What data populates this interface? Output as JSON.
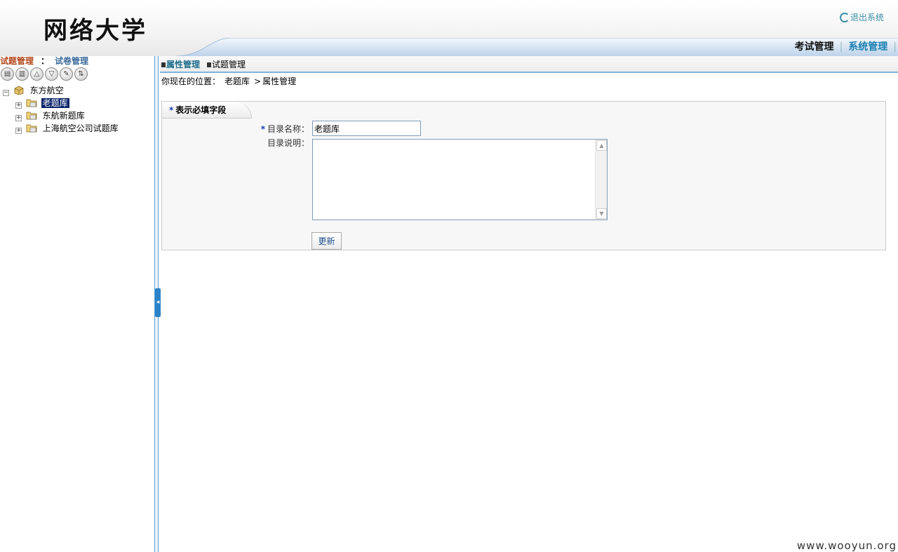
{
  "header": {
    "title": "网络大学",
    "logout_label": "退出系统",
    "nav": {
      "exam_label": "考试管理",
      "separator": "|",
      "system_label": "系统管理"
    }
  },
  "left": {
    "tab_question": "试题管理",
    "tab_colon": "：",
    "tab_paper": "试卷管理",
    "toolbar": [
      {
        "icon": "add-folder-icon"
      },
      {
        "icon": "delete-icon"
      },
      {
        "icon": "move-up-icon"
      },
      {
        "icon": "move-down-icon"
      },
      {
        "icon": "edit-icon"
      },
      {
        "icon": "sort-icon"
      }
    ],
    "tree": {
      "root": {
        "label": "东方航空",
        "expander": "−"
      },
      "children": [
        {
          "label": "老题库",
          "expander": "+",
          "selected": true
        },
        {
          "label": "东航新题库",
          "expander": "+",
          "selected": false
        },
        {
          "label": "上海航空公司试题库",
          "expander": "+",
          "selected": false
        }
      ]
    }
  },
  "main": {
    "subtabs": {
      "active": "属性管理",
      "other": "试题管理"
    },
    "breadcrumb": {
      "prefix": "你现在的位置：",
      "root": "老题库",
      "arrow": ">",
      "current": "属性管理"
    },
    "form": {
      "legend_star": "*",
      "legend": "表示必填字段",
      "name_star": "*",
      "name_label": "目录名称：",
      "name_value": "老题库",
      "desc_label": "目录说明：",
      "desc_value": "",
      "update_label": "更新"
    }
  },
  "watermark": "www.wooyun.org",
  "colors": {
    "accent": "#1b7fb2",
    "splitter": "#2b83c9",
    "selected_bg": "#0a246a"
  }
}
